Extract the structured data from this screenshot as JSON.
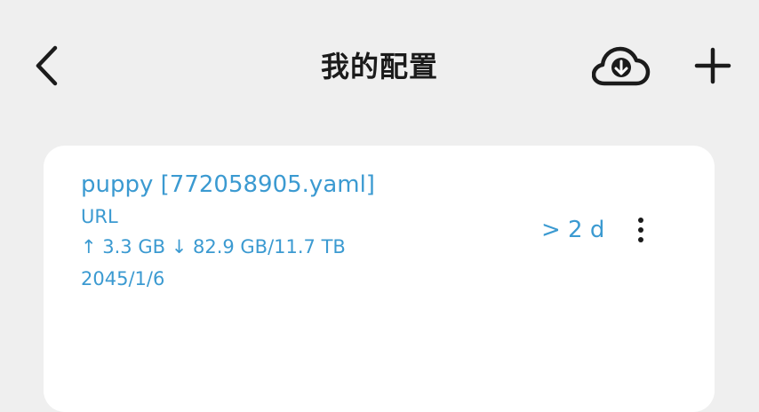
{
  "header": {
    "title": "我的配置",
    "back_icon": "chevron-left-icon",
    "cloud_icon": "cloud-download-icon",
    "add_icon": "plus-icon"
  },
  "profile": {
    "name": "puppy [772058905.yaml]",
    "type": "URL",
    "traffic": "↑ 3.3 GB ↓ 82.9 GB/11.7 TB",
    "expire": "2045/1/6",
    "remaining": "> 2 d",
    "more_icon": "more-vertical-icon"
  },
  "colors": {
    "background": "#efefef",
    "card": "#ffffff",
    "accent": "#3b9ad1",
    "text": "#1b1b1b"
  }
}
